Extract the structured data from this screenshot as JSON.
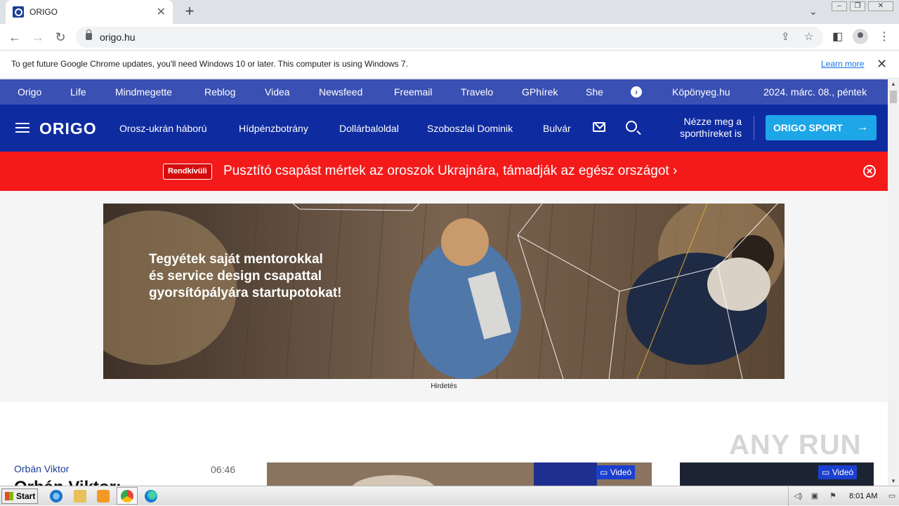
{
  "browser": {
    "tab_title": "ORIGO",
    "url": "origo.hu"
  },
  "infobar": {
    "message": "To get future Google Chrome updates, you'll need Windows 10 or later. This computer is using Windows 7.",
    "link": "Learn more"
  },
  "topnav": {
    "items": [
      "Origo",
      "Life",
      "Mindmegette",
      "Reblog",
      "Videa",
      "Newsfeed",
      "Freemail",
      "Travelo",
      "GPhírek",
      "She"
    ],
    "weather": "Köpönyeg.hu",
    "date": "2024. márc. 08., péntek"
  },
  "mainnav": {
    "logo": "ORIGO",
    "links": [
      "Orosz-ukrán háború",
      "Hídpénzbotrány",
      "Dollárbaloldal",
      "Szoboszlai Dominik",
      "Bulvár"
    ],
    "sport_hint_line1": "Nézze meg a",
    "sport_hint_line2": "sporthíreket is",
    "sport_button": "ORIGO SPORT"
  },
  "breaking": {
    "badge": "Rendkívüli",
    "text": "Pusztító csapást mértek az oroszok Ukrajnára, támadják az egész országot"
  },
  "ad": {
    "line1": "Tegyétek saját mentorokkal",
    "line2": "és service design csapattal",
    "line3": "gyorsítópályára startupotokat!",
    "label": "Hirdetés"
  },
  "article": {
    "category": "Orbán Viktor",
    "time": "06:46",
    "headline": "Orbán Viktor: "
  },
  "video_badge": "Videó",
  "watermark": "ANY RUN",
  "taskbar": {
    "start": "Start",
    "clock": "8:01 AM"
  },
  "colors": {
    "topnav_bg": "#3a50b3",
    "mainnav_bg": "#0f2ba0",
    "breaking_bg": "#f41a1a",
    "sport_button_bg": "#1ea7e8"
  }
}
